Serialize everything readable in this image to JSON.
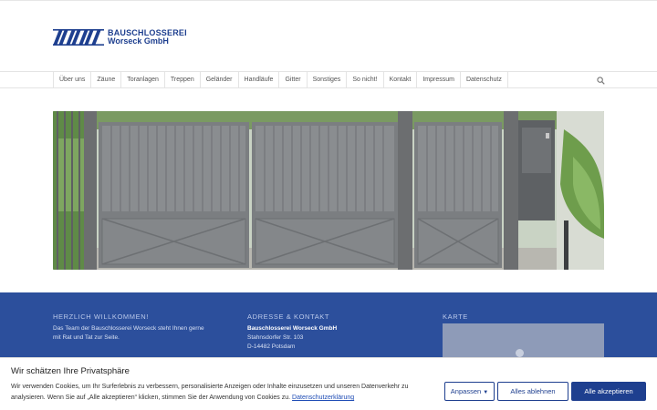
{
  "brand": {
    "name_line1": "BAUSCHLOSSEREI",
    "name_line2": "Worseck GmbH",
    "color": "#1e3f8f"
  },
  "nav": {
    "items": [
      "Über uns",
      "Zäune",
      "Toranlagen",
      "Treppen",
      "Geländer",
      "Handläufe",
      "Gitter",
      "Sonstiges",
      "So nicht!",
      "Kontakt",
      "Impressum",
      "Datenschutz"
    ],
    "search_icon": "search-icon"
  },
  "footer": {
    "background": "#2c4f9c",
    "welcome": {
      "heading": "HERZLICH WILLKOMMEN!",
      "text_line1": "Das Team der Bauschlosserei Worseck steht Ihnen gerne",
      "text_line2": "mit Rat und Tat zur Seite."
    },
    "contact": {
      "heading": "ADRESSE & KONTAKT",
      "company": "Bauschlosserei Worseck GmbH",
      "street": "Stahnsdorfer Str. 103",
      "city": "D-14482 Potsdam"
    },
    "map": {
      "heading": "KARTE"
    }
  },
  "cookie_banner": {
    "title": "Wir schätzen Ihre Privatsphäre",
    "text_line1": "Wir verwenden Cookies, um Ihr Surferlebnis zu verbessern, personalisierte Anzeigen oder Inhalte einzusetzen und unseren Datenverkehr zu",
    "text_line2": "analysieren. Wenn Sie auf „Alle akzeptieren“ klicken, stimmen Sie der Anwendung von Cookies zu.",
    "link_label": "Datenschutzerklärung",
    "customize_label": "Anpassen",
    "reject_label": "Alles ablehnen",
    "accept_label": "Alle akzeptieren"
  }
}
